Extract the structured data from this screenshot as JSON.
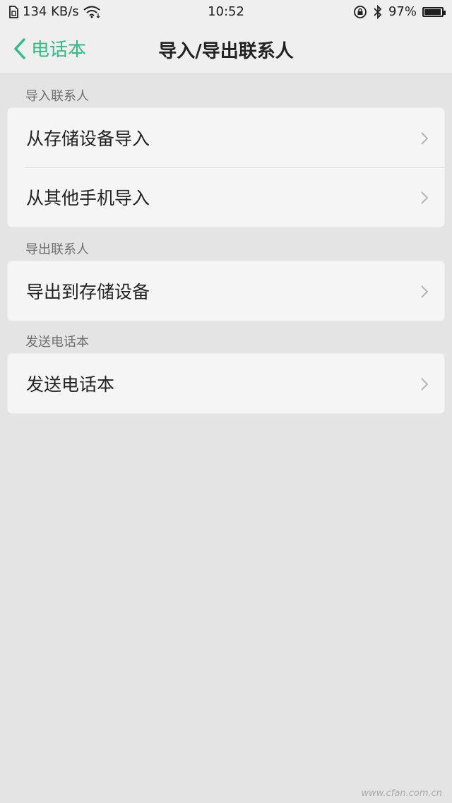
{
  "status_bar": {
    "network_speed": "134 KB/s",
    "time": "10:52",
    "battery_percent": "97%",
    "battery_level": 0.97
  },
  "nav": {
    "back_label": "电话本",
    "title": "导入/导出联系人"
  },
  "sections": [
    {
      "header": "导入联系人",
      "items": [
        "从存储设备导入",
        "从其他手机导入"
      ]
    },
    {
      "header": "导出联系人",
      "items": [
        "导出到存储设备"
      ]
    },
    {
      "header": "发送电话本",
      "items": [
        "发送电话本"
      ]
    }
  ],
  "watermark": "www.cfan.com.cn",
  "colors": {
    "accent": "#2ebd86",
    "background": "#e4e4e4",
    "card": "#f5f5f5"
  }
}
